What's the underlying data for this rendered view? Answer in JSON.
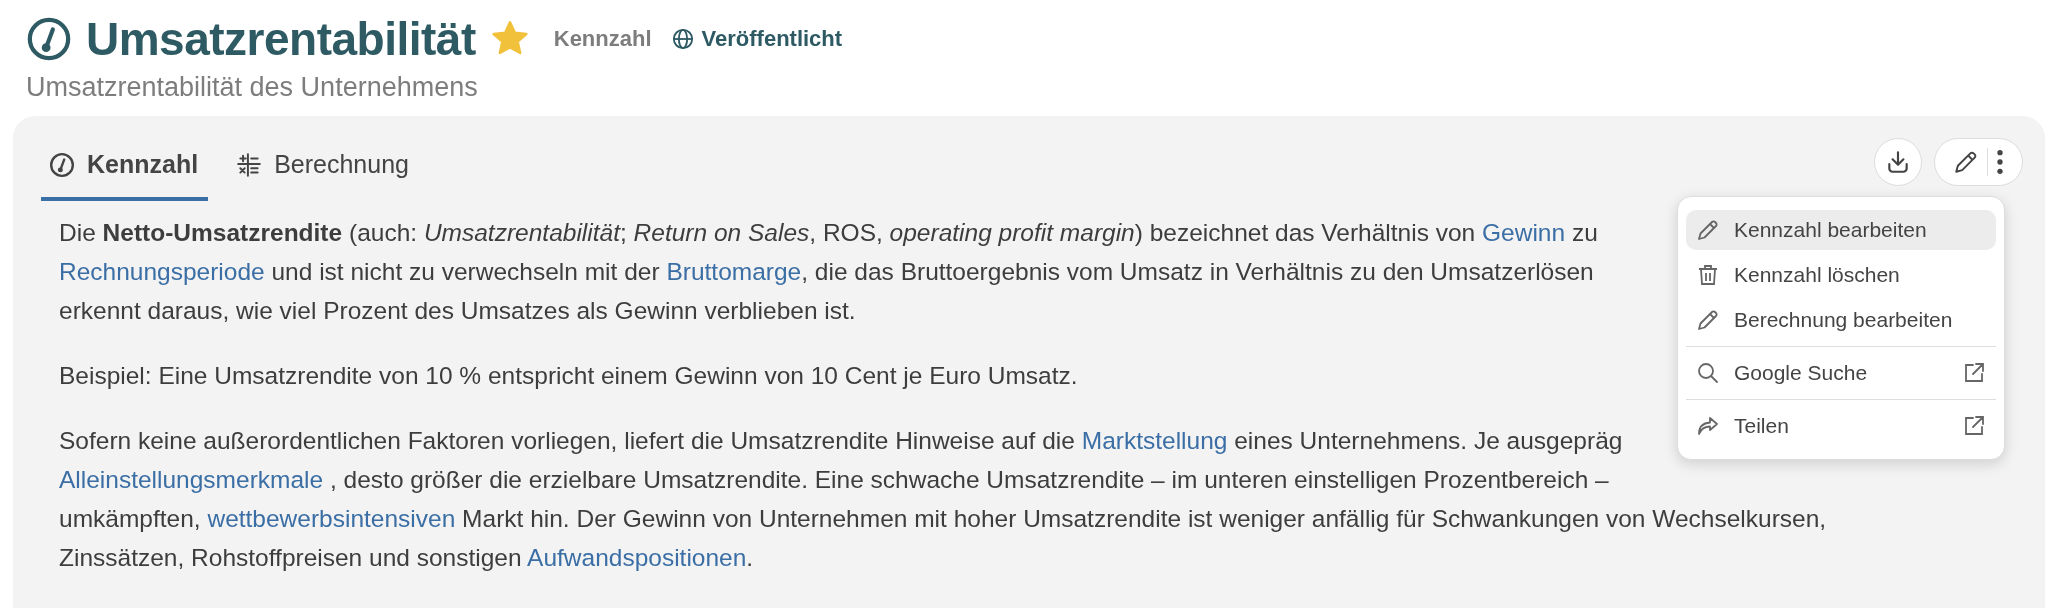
{
  "header": {
    "title": "Umsatzrentabilität",
    "starred": true,
    "type_label": "Kennzahl",
    "status": "Veröffentlicht",
    "subtitle": "Umsatzrentabilität des Unternehmens"
  },
  "tabs": [
    {
      "label": "Kennzahl",
      "selected": true
    },
    {
      "label": "Berechnung",
      "selected": false
    }
  ],
  "paragraphs": [
    [
      [
        {
          "text": "Die **Netto-Umsatzrendite** (auch: *Umsatzrentabilität*; *Return on Sales*, ROS, *operating profit margin*) bezeichnet das Verhältnis von "
        },
        {
          "link": "Gewinn"
        },
        {
          "text": " zu"
        }
      ],
      [
        {
          "link": "Rechnungsperiode"
        },
        {
          "text": " und ist nicht zu verwechseln mit der "
        },
        {
          "link": "Bruttomarge"
        },
        {
          "text": ", die das Bruttoergebnis vom Umsatz in Verhältnis zu den Umsatzerlösen"
        }
      ],
      [
        {
          "text": "erkennt daraus, wie viel Prozent des Umsatzes als Gewinn verblieben ist."
        }
      ]
    ],
    [
      [
        {
          "text": "Beispiel: Eine Umsatzrendite von 10 % entspricht einem Gewinn von 10 Cent je Euro Umsatz."
        }
      ]
    ],
    [
      [
        {
          "text": "Sofern keine außerordentlichen Faktoren vorliegen, liefert die Umsatzrendite Hinweise auf die "
        },
        {
          "link": "Marktstellung"
        },
        {
          "text": " eines Unternehmens. Je ausgepräg"
        }
      ],
      [
        {
          "link": "Alleinstellungsmerkmale"
        },
        {
          "text": " , desto größer die erzielbare Umsatzrendite. Eine schwache Umsatzrendite – im unteren einstelligen Prozentbereich –"
        }
      ],
      [
        {
          "text": "umkämpften, "
        },
        {
          "link": "wettbewerbsintensiven"
        },
        {
          "text": " Markt hin. Der Gewinn von Unternehmen mit hoher Umsatzrendite ist weniger anfällig für Schwankungen von Wechselkursen,"
        }
      ],
      [
        {
          "text": "Zinssätzen, Rohstoffpreisen und sonstigen "
        },
        {
          "link": "Aufwandspositionen"
        },
        {
          "text": "."
        }
      ]
    ]
  ],
  "menu": {
    "sections": [
      [
        {
          "label": "Kennzahl bearbeiten",
          "highlighted": true,
          "external": false
        },
        {
          "label": "Kennzahl löschen",
          "highlighted": false,
          "external": false
        },
        {
          "label": "Berechnung bearbeiten",
          "highlighted": false,
          "external": false
        }
      ],
      [
        {
          "label": "Google Suche",
          "highlighted": false,
          "external": true
        }
      ],
      [
        {
          "label": "Teilen",
          "highlighted": false,
          "external": true
        }
      ]
    ]
  }
}
